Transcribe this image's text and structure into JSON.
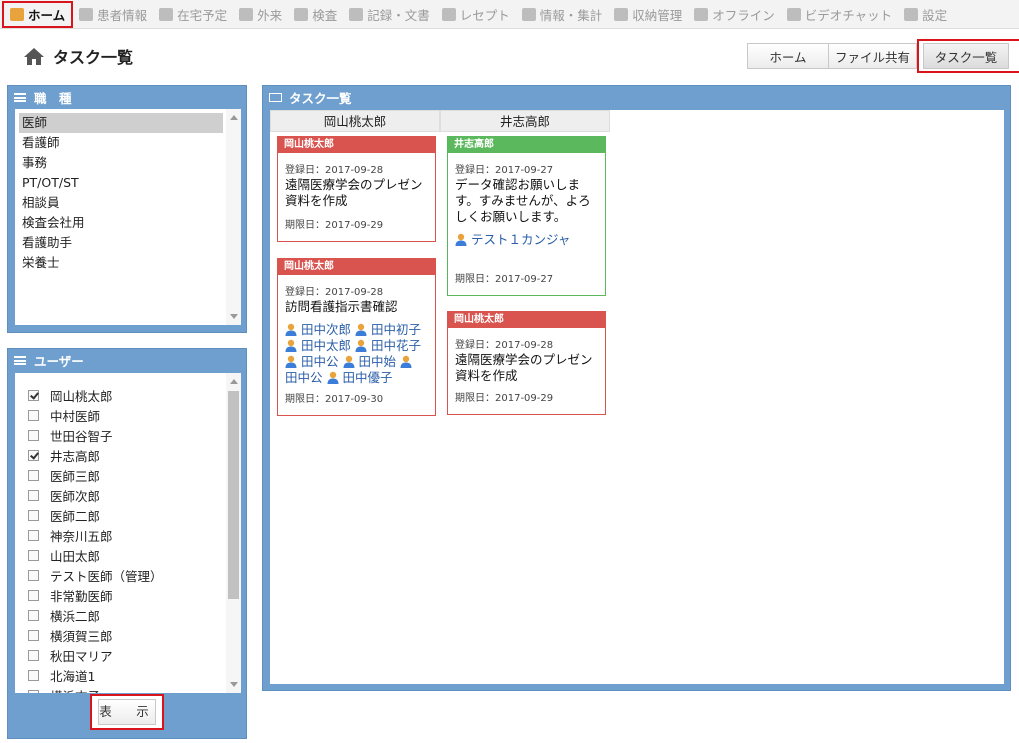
{
  "nav": [
    {
      "label": "ホーム",
      "icon": "home-icon",
      "active": true
    },
    {
      "label": "患者情報",
      "icon": "patient-icon"
    },
    {
      "label": "在宅予定",
      "icon": "schedule-icon"
    },
    {
      "label": "外来",
      "icon": "outpatient-icon"
    },
    {
      "label": "検査",
      "icon": "test-icon"
    },
    {
      "label": "記録・文書",
      "icon": "document-icon"
    },
    {
      "label": "レセプト",
      "icon": "receipt-icon"
    },
    {
      "label": "情報・集計",
      "icon": "stats-icon"
    },
    {
      "label": "収納管理",
      "icon": "payment-icon"
    },
    {
      "label": "オフライン",
      "icon": "offline-icon"
    },
    {
      "label": "ビデオチャット",
      "icon": "video-icon"
    },
    {
      "label": "設定",
      "icon": "gear-icon"
    }
  ],
  "page_title": "タスク一覧",
  "tabs": {
    "home": "ホーム",
    "files": "ファイル共有",
    "tasks": "タスク一覧"
  },
  "job_panel": {
    "title": "職　種",
    "items": [
      "医師",
      "看護師",
      "事務",
      "PT/OT/ST",
      "相談員",
      "検査会社用",
      "看護助手",
      "栄養士"
    ],
    "selected": 0
  },
  "user_panel": {
    "title": "ユーザー",
    "items": [
      {
        "name": "岡山桃太郎",
        "checked": true
      },
      {
        "name": "中村医師",
        "checked": false
      },
      {
        "name": "世田谷智子",
        "checked": false
      },
      {
        "name": "井志高郎",
        "checked": true
      },
      {
        "name": "医師三郎",
        "checked": false
      },
      {
        "name": "医師次郎",
        "checked": false
      },
      {
        "name": "医師二郎",
        "checked": false
      },
      {
        "name": "神奈川五郎",
        "checked": false
      },
      {
        "name": "山田太郎",
        "checked": false
      },
      {
        "name": "テスト医師（管理）",
        "checked": false
      },
      {
        "name": "非常勤医師",
        "checked": false
      },
      {
        "name": "横浜二郎",
        "checked": false
      },
      {
        "name": "横須賀三郎",
        "checked": false
      },
      {
        "name": "秋田マリア",
        "checked": false
      },
      {
        "name": "北海道1",
        "checked": false
      },
      {
        "name": "横浜末子",
        "checked": false
      }
    ],
    "show_button": "表　示"
  },
  "task_panel": {
    "title": "タスク一覧",
    "columns": [
      "岡山桃太郎",
      "井志高郎"
    ]
  },
  "cards": [
    {
      "owner": "岡山桃太郎",
      "registered": "登録日：2017-09-28",
      "title": "遠隔医療学会のプレゼン資料を作成",
      "users": "",
      "due": "期限日：2017-09-29",
      "color": "#d9534f"
    },
    {
      "owner": "岡山桃太郎",
      "registered": "登録日：2017-09-28",
      "title": "訪問看護指示書確認",
      "users": [
        "田中次郎",
        "田中初子",
        "田中太郎",
        "田中花子",
        "田中公",
        "田中始",
        "田中公",
        "田中優子"
      ],
      "due": "期限日：2017-09-30",
      "color": "#d9534f"
    },
    {
      "owner": "井志高郎",
      "registered": "登録日：2017-09-27",
      "title": "データ確認お願いします。すみませんが、よろしくお願いします。",
      "users": [
        "テスト１カンジャ"
      ],
      "due": "期限日：2017-09-27",
      "color": "#5cb85c"
    },
    {
      "owner": "岡山桃太郎",
      "registered": "登録日：2017-09-28",
      "title": "遠隔医療学会のプレゼン資料を作成",
      "users": "",
      "due": "期限日：2017-09-29",
      "color": "#d9534f"
    }
  ]
}
